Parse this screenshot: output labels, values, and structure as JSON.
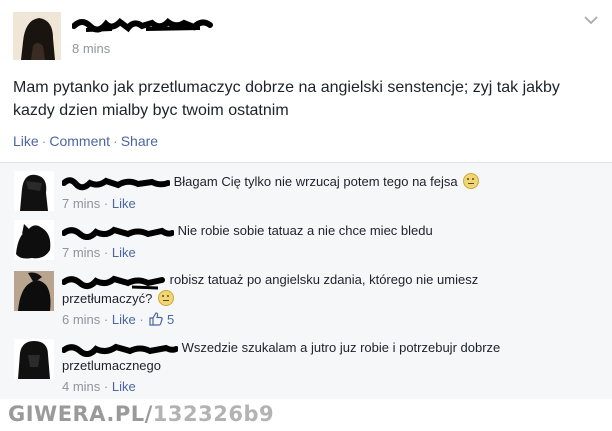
{
  "post": {
    "timestamp": "8 mins",
    "text": "Mam pytanko jak przetlumaczyc dobrze na angielski senstencje; zyj tak jakby kazdy dzien mialby byc twoim ostatnim",
    "actions": {
      "like": "Like",
      "comment": "Comment",
      "share": "Share"
    },
    "menu_icon": "chevron-down-icon"
  },
  "comments": [
    {
      "text": "Błagam Cię tylko nie wrzucaj potem tego na fejsa",
      "time": "7 mins",
      "like": "Like",
      "emoji": "smiley-icon"
    },
    {
      "text": "Nie robie sobie tatuaz a nie chce miec bledu",
      "time": "7 mins",
      "like": "Like"
    },
    {
      "text_line1": "robisz tatuaż po angielsku zdania, którego nie umiesz",
      "text_line2": "przetłumaczyć?",
      "time": "6 mins",
      "like": "Like",
      "like_count": "5",
      "emoji": "smiley-icon"
    },
    {
      "text_line1": "Wszedzie szukalam a jutro juz robie i potrzebujr dobrze",
      "text_line2": "przetlumacznego",
      "time": "4 mins",
      "like": "Like"
    }
  ],
  "watermark": {
    "site": "GIWERA.PL/",
    "id": "132326b9"
  }
}
